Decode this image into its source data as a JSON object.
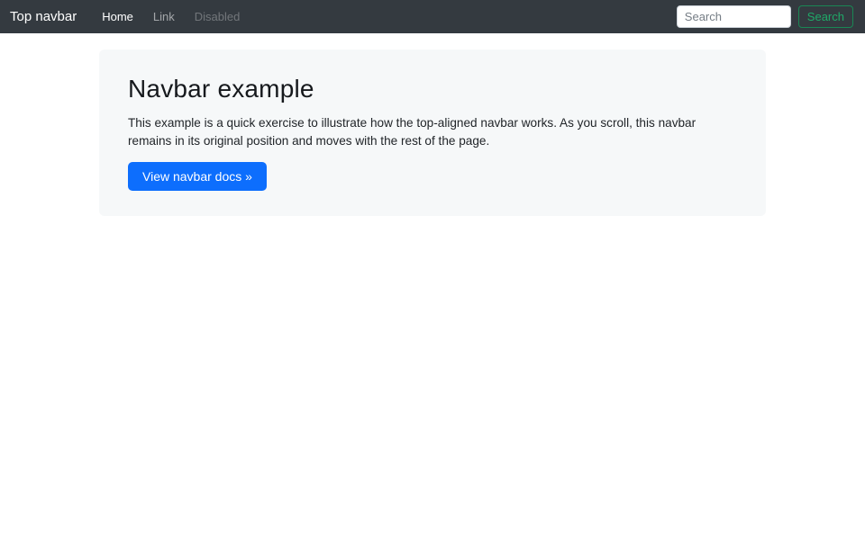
{
  "navbar": {
    "brand": "Top navbar",
    "links": [
      {
        "label": "Home",
        "state": "active"
      },
      {
        "label": "Link",
        "state": "normal"
      },
      {
        "label": "Disabled",
        "state": "disabled"
      }
    ],
    "search": {
      "placeholder": "Search",
      "button_label": "Search"
    }
  },
  "jumbotron": {
    "title": "Navbar example",
    "description": "This example is a quick exercise to illustrate how the top-aligned navbar works. As you scroll, this navbar remains in its original position and moves with the rest of the page.",
    "cta_label": "View navbar docs »"
  },
  "colors": {
    "navbar_bg": "#343a40",
    "primary": "#0d6efd",
    "success_outline": "#198754",
    "jumbotron_bg": "#f6f8f9",
    "body_bg": "#ffffff",
    "text": "#212529"
  }
}
